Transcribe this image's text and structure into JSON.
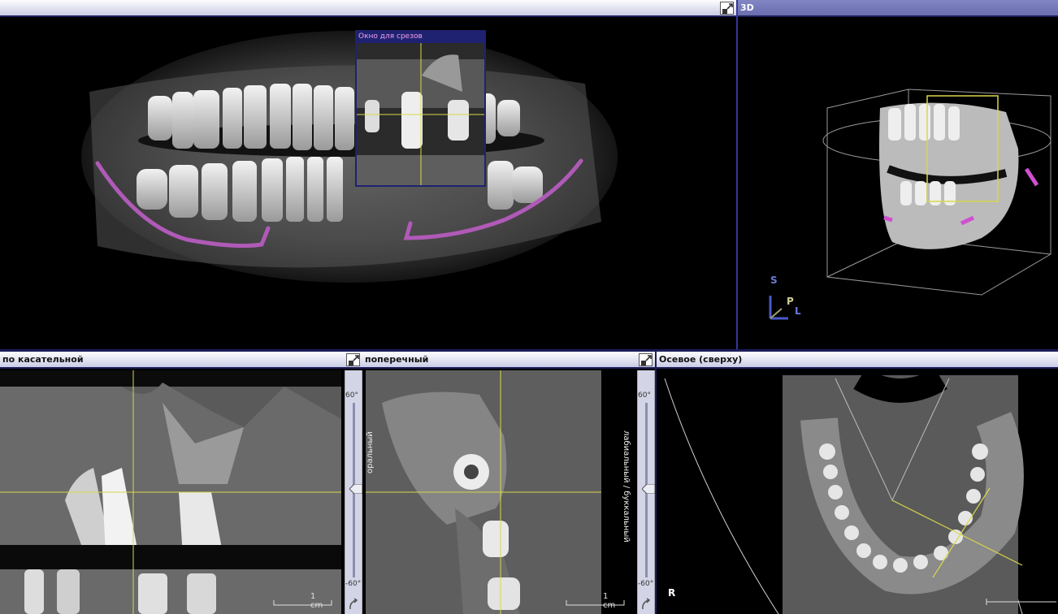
{
  "panes": {
    "panoramic": {
      "title": ""
    },
    "three_d": {
      "title": "3D"
    },
    "tangential": {
      "title": "по касательной"
    },
    "cross": {
      "title": "поперечный"
    },
    "axial": {
      "title": "Осевое (сверху)"
    }
  },
  "slice_window": {
    "label": "Окно для срезов"
  },
  "sliders": {
    "top": "60°",
    "bottom": "-60°"
  },
  "scale_bar": {
    "label": "1 cm"
  },
  "orientation": {
    "s": "S",
    "p": "P",
    "l": "L"
  },
  "cross_labels": {
    "left": "оральный",
    "right": "лабиальный / буккальный"
  },
  "axial_marker": "R",
  "icons": [
    "maximize-icon",
    "rotate-icon"
  ],
  "colors": {
    "title_text": "#111111",
    "border": "#1c1d58",
    "nerve_canal": "#b05ab8",
    "crosshair": "#d8d84a"
  }
}
